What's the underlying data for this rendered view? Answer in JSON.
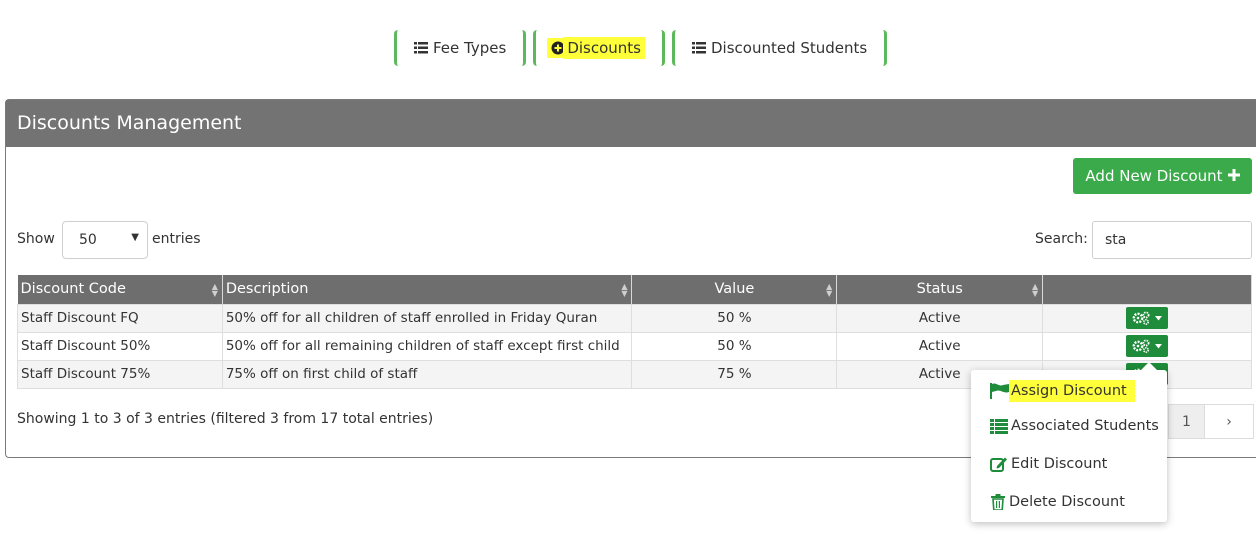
{
  "tabs": [
    {
      "label": "Fee Types",
      "icon": "list-icon"
    },
    {
      "label": "Discounts",
      "icon": "plus-circle-icon"
    },
    {
      "label": "Discounted Students",
      "icon": "list-icon"
    }
  ],
  "panel": {
    "title": "Discounts Management",
    "add_button": "Add New Discount"
  },
  "length": {
    "show_label": "Show",
    "value": "50",
    "entries_label": "entries"
  },
  "search": {
    "label": "Search:",
    "value": "sta"
  },
  "table": {
    "headers": [
      "Discount Code",
      "Description",
      "Value",
      "Status",
      ""
    ],
    "rows": [
      {
        "code": "Staff Discount FQ",
        "description": "50% off for all children of staff enrolled in Friday Quran",
        "value": "50 %",
        "status": "Active"
      },
      {
        "code": "Staff Discount 50%",
        "description": "50% off for all remaining children of staff except first child",
        "value": "50 %",
        "status": "Active"
      },
      {
        "code": "Staff Discount 75%",
        "description": "75% off on first child of staff",
        "value": "75 %",
        "status": "Active"
      }
    ]
  },
  "info": "Showing 1 to 3 of 3 entries (filtered 3 from 17 total entries)",
  "pager": {
    "current": "1",
    "next": "›"
  },
  "dropdown": [
    {
      "label": "Assign Discount",
      "icon": "flag-icon"
    },
    {
      "label": "Associated Students",
      "icon": "list-icon"
    },
    {
      "label": "Edit Discount",
      "icon": "edit-icon"
    },
    {
      "label": "Delete Discount",
      "icon": "trash-icon"
    }
  ],
  "colors": {
    "accent": "#3aaa4a",
    "dark_green": "#1e8c3a",
    "header": "#737373",
    "highlight": "#ffff3a"
  }
}
